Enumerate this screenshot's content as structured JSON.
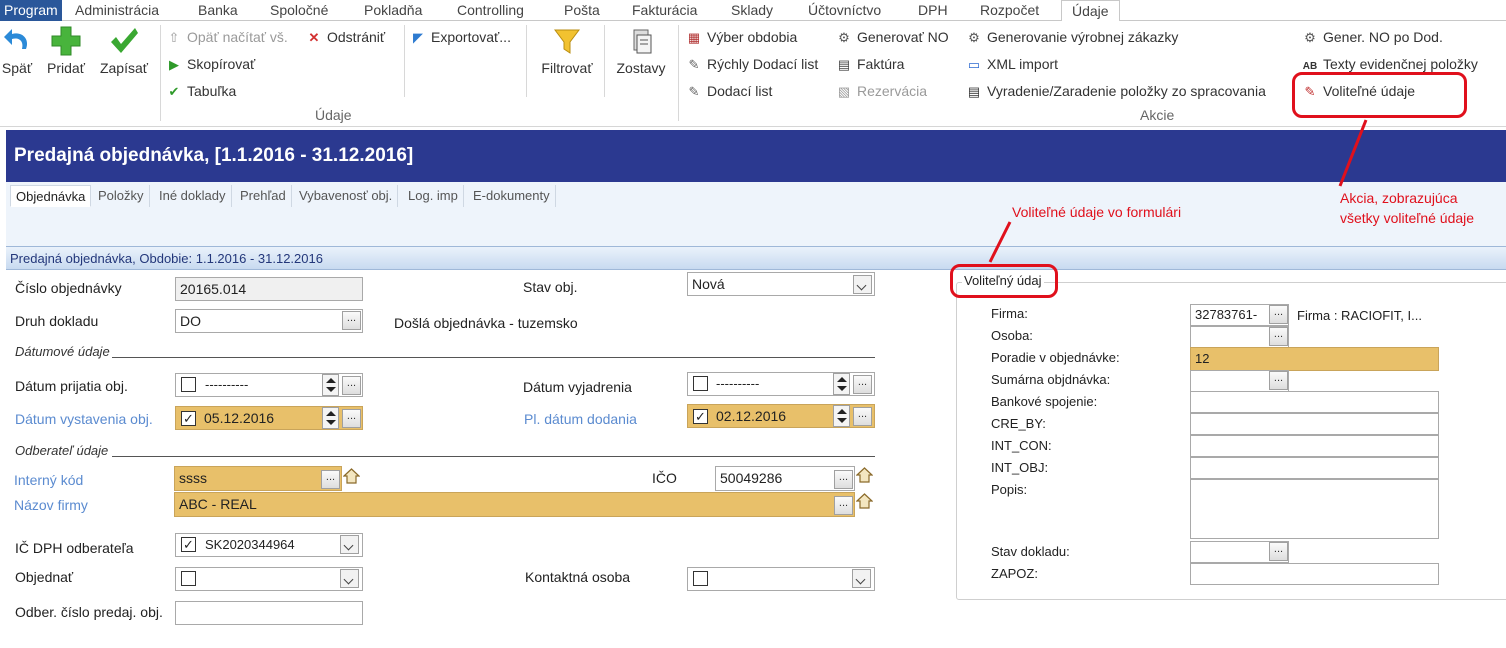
{
  "menu": {
    "program": "Program",
    "items": [
      "Administrácia",
      "Banka",
      "Spoločné",
      "Pokladňa",
      "Controlling",
      "Pošta",
      "Fakturácia",
      "Sklady",
      "Účtovníctvo",
      "DPH",
      "Rozpočet"
    ],
    "active": "Údaje"
  },
  "ribbon": {
    "back": "Späť",
    "add": "Pridať",
    "save": "Zapísať",
    "reload": "Opäť načítať vš.",
    "remove": "Odstrániť",
    "copy": "Skopírovať",
    "table": "Tabuľka",
    "export": "Exportovať...",
    "filter": "Filtrovať",
    "reports": "Zostavy",
    "group_data": "Údaje",
    "group_actions": "Akcie",
    "period_select": "Výber obdobia",
    "quick_delivery": "Rýchly Dodací list",
    "delivery_note": "Dodací list",
    "generate_no": "Generovať NO",
    "invoice": "Faktúra",
    "reservation": "Rezervácia",
    "gen_production": "Generovanie výrobnej zákazky",
    "xml_import": "XML import",
    "exclude_include": "Vyradenie/Zaradenie položky zo spracovania",
    "gen_no_by_sup": "Gener. NO po Dod.",
    "item_texts": "Texty evidenčnej položky",
    "optional_data": "Voliteľné údaje"
  },
  "title": "Predajná objednávka,  [1.1.2016 - 31.12.2016]",
  "tabs": [
    "Objednávka",
    "Položky",
    "Iné doklady",
    "Prehľad",
    "Vybavenosť obj.",
    "Log. imp",
    "E-dokumenty"
  ],
  "section_header": "Predajná objednávka, Obdobie: 1.1.2016 - 31.12.2016",
  "form": {
    "order_number_label": "Číslo objednávky",
    "order_number": "20165.014",
    "doc_type_label": "Druh dokladu",
    "doc_type": "DO",
    "doc_type_desc": "Došlá objednávka - tuzemsko",
    "status_label": "Stav obj.",
    "status": "Nová",
    "dates_group": "Dátumové údaje",
    "received_date_label": "Dátum prijatia obj.",
    "received_date": "----------",
    "response_date_label": "Dátum vyjadrenia",
    "response_date": "----------",
    "issue_date_label": "Dátum vystavenia obj.",
    "issue_date": "05.12.2016",
    "delivery_date_label": "Pl. dátum dodania",
    "delivery_date": "02.12.2016",
    "customer_group": "Odberateľ údaje",
    "internal_code_label": "Interný kód",
    "internal_code": "ssss",
    "ico_label": "IČO",
    "ico": "50049286",
    "company_name_label": "Názov firmy",
    "company_name": "ABC - REAL",
    "vat_id_label": "IČ DPH odberateľa",
    "vat_id": "SK2020344964",
    "order_label": "Objednať",
    "contact_label": "Kontaktná osoba",
    "cust_order_no_label": "Odber. číslo predaj. obj."
  },
  "optional_panel": {
    "title": "Voliteľný údaj",
    "firma_label": "Firma:",
    "firma_value": "32783761-",
    "firma_desc": "Firma : RACIOFIT, I...",
    "osoba_label": "Osoba:",
    "poradie_label": "Poradie v objednávke:",
    "poradie_value": "12",
    "sumarna_label": "Sumárna objdnávka:",
    "bank_label": "Bankové spojenie:",
    "cre_by_label": "CRE_BY:",
    "int_con_label": "INT_CON:",
    "int_obj_label": "INT_OBJ:",
    "popis_label": "Popis:",
    "stav_label": "Stav dokladu:",
    "zapoz_label": "ZAPOZ:"
  },
  "annotations": {
    "form_note": "Voliteľné údaje vo formulári",
    "action_note_1": "Akcia, zobrazujúca",
    "action_note_2": "všetky voliteľné údaje"
  },
  "colors": {
    "title_bg": "#2b3990",
    "highlight": "#e8c06a",
    "annotation": "#e0101c",
    "label_blue": "#5b8bd0"
  }
}
